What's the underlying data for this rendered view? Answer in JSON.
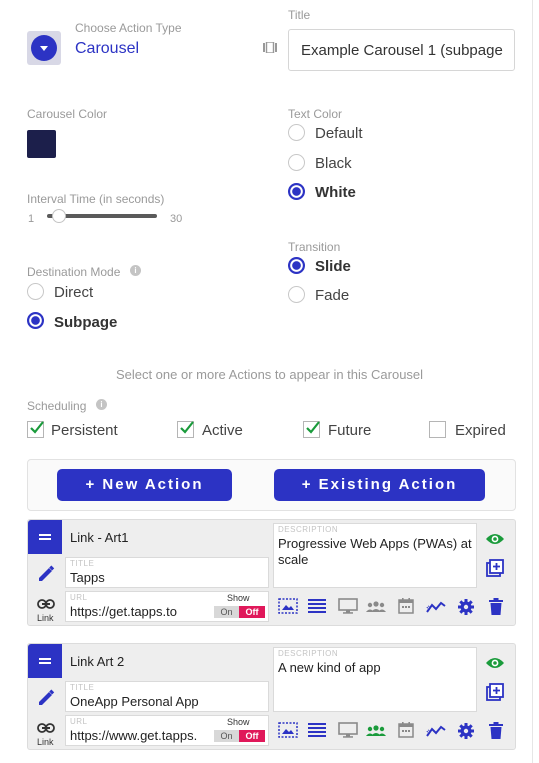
{
  "action_type": {
    "label": "Choose Action Type",
    "value": "Carousel"
  },
  "title_field": {
    "label": "Title",
    "value": "Example Carousel 1 (subpage"
  },
  "carousel_color": {
    "label": "Carousel Color",
    "color": "#1c1f4b"
  },
  "text_color": {
    "label": "Text Color",
    "options": [
      "Default",
      "Black",
      "White"
    ],
    "selected": "White"
  },
  "interval": {
    "label": "Interval Time (in seconds)",
    "min": "1",
    "max": "30",
    "value": 3
  },
  "transition": {
    "label": "Transition",
    "options": [
      "Slide",
      "Fade"
    ],
    "selected": "Slide"
  },
  "destination_mode": {
    "label": "Destination Mode",
    "options": [
      "Direct",
      "Subpage"
    ],
    "selected": "Subpage"
  },
  "select_hint": "Select one or more Actions to appear in this Carousel",
  "scheduling": {
    "label": "Scheduling",
    "options": [
      {
        "label": "Persistent",
        "checked": true
      },
      {
        "label": "Active",
        "checked": true
      },
      {
        "label": "Future",
        "checked": true
      },
      {
        "label": "Expired",
        "checked": false
      }
    ]
  },
  "buttons": {
    "new_action": "+ New Action",
    "existing_action": "+ Existing Action"
  },
  "actions": [
    {
      "name": "Link - Art1",
      "title_label": "TITLE",
      "title": "Tapps",
      "url_label": "URL",
      "url": "https://get.tapps.to",
      "description_label": "DESCRIPTION",
      "description": "Progressive Web Apps (PWAs) at scale",
      "link_label": "Link",
      "show_label": "Show",
      "toggle_on": "On",
      "toggle_off": "Off",
      "show": false
    },
    {
      "name": "Link Art 2",
      "title_label": "TITLE",
      "title": "OneApp Personal App",
      "url_label": "URL",
      "url": "https://www.get.tapps.",
      "description_label": "DESCRIPTION",
      "description": "A new kind of app",
      "link_label": "Link",
      "show_label": "Show",
      "toggle_on": "On",
      "toggle_off": "Off",
      "show": false
    }
  ],
  "colors": {
    "accent": "#2c33c4",
    "green": "#1a9b3b",
    "toggle_off": "#e0185a"
  }
}
